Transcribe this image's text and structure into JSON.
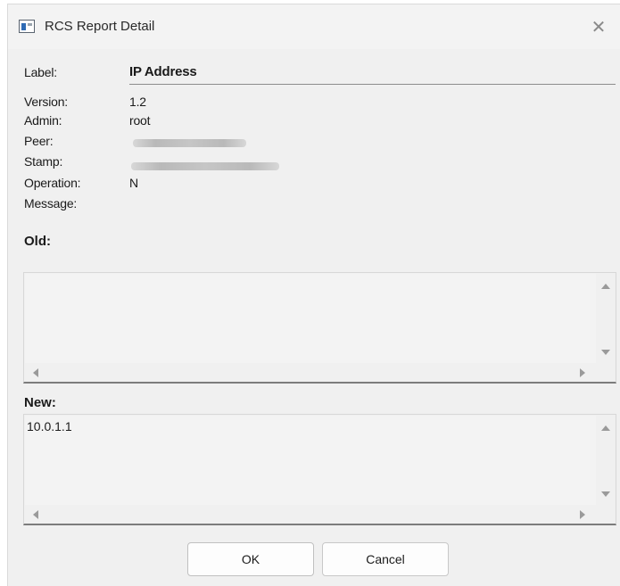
{
  "window": {
    "title": "RCS Report Detail",
    "close_glyph": "✕"
  },
  "fields": {
    "label": {
      "name": "Label:",
      "value": "IP Address"
    },
    "version": {
      "name": "Version:",
      "value": "1.2"
    },
    "admin": {
      "name": "Admin:",
      "value": "root"
    },
    "peer": {
      "name": "Peer:"
    },
    "stamp": {
      "name": "Stamp:"
    },
    "operation": {
      "name": "Operation:",
      "value": "N"
    },
    "message": {
      "name": "Message:",
      "value": ""
    }
  },
  "old_section": {
    "title": "Old:",
    "value": ""
  },
  "new_section": {
    "title": "New:",
    "value": "10.0.1.1"
  },
  "buttons": {
    "ok": "OK",
    "cancel": "Cancel"
  },
  "icons": {
    "app": "window-app-icon",
    "close": "close-icon",
    "scroll_up": "chevron-up-icon",
    "scroll_down": "chevron-down-icon",
    "scroll_left": "chevron-left-icon",
    "scroll_right": "chevron-right-icon"
  }
}
